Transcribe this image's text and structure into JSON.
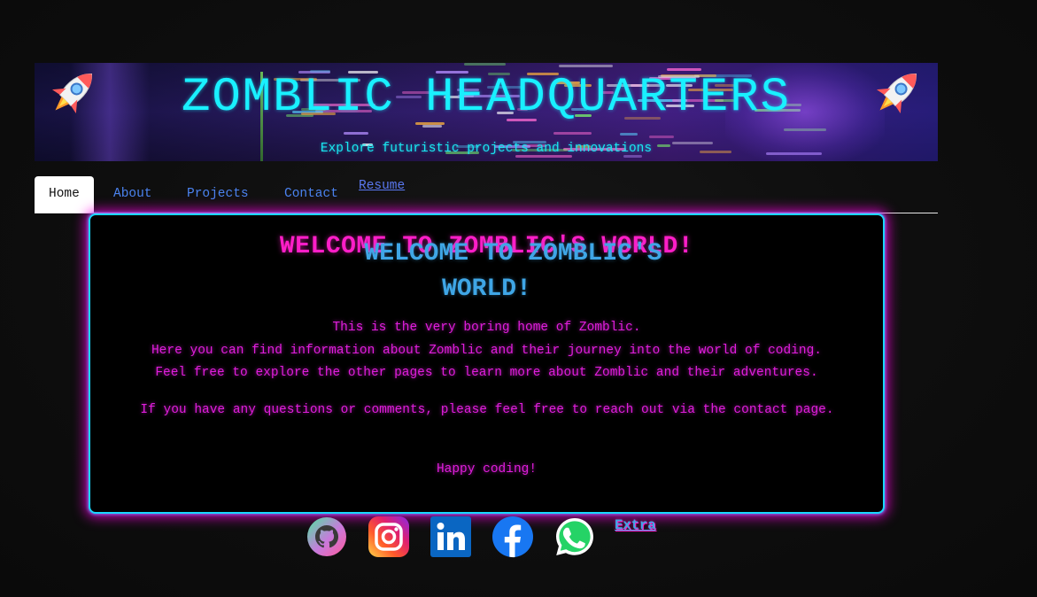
{
  "banner": {
    "title": "ZOMBLIC HEADQUARTERS",
    "subtitle": "Explore futuristic projects and innovations"
  },
  "nav": {
    "items": [
      {
        "label": "Home",
        "active": true
      },
      {
        "label": "About"
      },
      {
        "label": "Projects"
      },
      {
        "label": "Contact"
      },
      {
        "label": "Resume"
      }
    ]
  },
  "main": {
    "welcome_pink": "WELCOME TO ZOMBLIC'S WORLD!",
    "welcome_cyan_line1": "WELCOME TO ZOMBLIC'S",
    "welcome_cyan_line2": "WORLD!",
    "intro_line1": "This is the very boring home of Zomblic.",
    "intro_line2": "Here you can find information about Zomblic and their journey into the world of coding.",
    "intro_line3": "Feel free to explore the other pages to learn more about Zomblic and their adventures.",
    "contact_text": "If you have any questions or comments, please feel free to reach out via the contact page.",
    "closing": "Happy coding!"
  },
  "social": {
    "icons": [
      "github-icon",
      "instagram-icon",
      "linkedin-icon",
      "facebook-icon",
      "whatsapp-icon"
    ],
    "extra_label": "Extra"
  },
  "colors": {
    "accent_cyan": "#19f0ff",
    "accent_pink": "#ff1ec8",
    "body_text_magenta": "#e01edc",
    "nav_link": "#4b82f0"
  }
}
